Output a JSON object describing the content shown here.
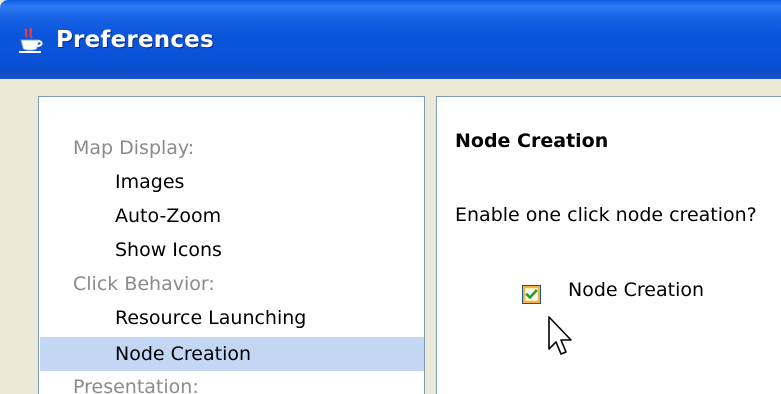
{
  "window": {
    "title": "Preferences",
    "icon": "java-coffee-cup-icon"
  },
  "tree": {
    "items": [
      {
        "label": "Map Display:",
        "kind": "category"
      },
      {
        "label": "Images",
        "kind": "option"
      },
      {
        "label": "Auto-Zoom",
        "kind": "option"
      },
      {
        "label": "Show Icons",
        "kind": "option"
      },
      {
        "label": "Click Behavior:",
        "kind": "category"
      },
      {
        "label": "Resource Launching",
        "kind": "option"
      },
      {
        "label": "Node Creation",
        "kind": "option",
        "selected": true
      },
      {
        "label": "Presentation:",
        "kind": "category"
      }
    ]
  },
  "panel": {
    "heading": "Node Creation",
    "question": "Enable one click node creation?",
    "checkbox": {
      "label": "Node Creation",
      "checked": true
    }
  },
  "colors": {
    "titlebar": "#0a55dd",
    "selection": "#c3d7f5",
    "category_text": "#8a8a8a",
    "checkmark": "#21a121",
    "checkbox_hover": "#f8b33f"
  }
}
